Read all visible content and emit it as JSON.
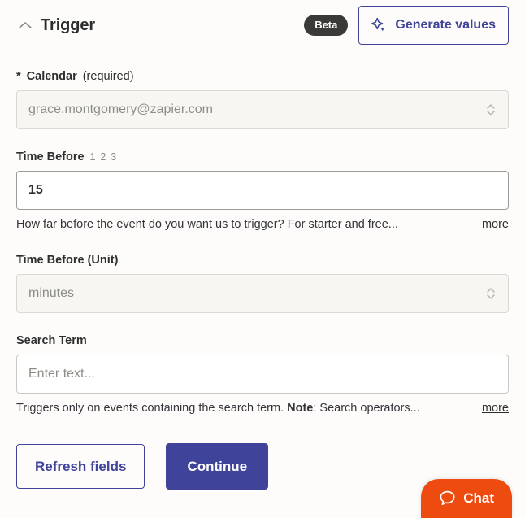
{
  "header": {
    "collapse_icon": "chevron-up-icon",
    "title": "Trigger",
    "beta_badge": "Beta",
    "generate_button": {
      "label": "Generate values",
      "icon": "sparkle-icon"
    }
  },
  "fields": [
    {
      "label": "Calendar",
      "required_marker": "*",
      "required_note": "(required)",
      "type": "select",
      "value": "grace.montgomery@zapier.com",
      "caret_icon": "chevron-up-down-icon"
    },
    {
      "label": "Time Before",
      "type_hint": "1 2 3",
      "type": "text",
      "value": "15",
      "help_text": "How far before the event do you want us to trigger? For starter and free...",
      "more_label": "more"
    },
    {
      "label": "Time Before (Unit)",
      "type": "select",
      "value": "minutes",
      "caret_icon": "chevron-up-down-icon"
    },
    {
      "label": "Search Term",
      "type": "text",
      "placeholder": "Enter text...",
      "help_text_prefix": "Triggers only on events containing the search term. ",
      "help_text_bold": "Note",
      "help_text_suffix": ": Search operators...",
      "more_label": "more"
    }
  ],
  "footer": {
    "refresh_label": "Refresh fields",
    "continue_label": "Continue"
  },
  "chat": {
    "label": "Chat",
    "icon": "speech-bubble-icon"
  },
  "colors": {
    "accent": "#3F4399",
    "chat": "#EE4B11",
    "badge": "#3A3A38",
    "background": "#FDFCFA"
  }
}
